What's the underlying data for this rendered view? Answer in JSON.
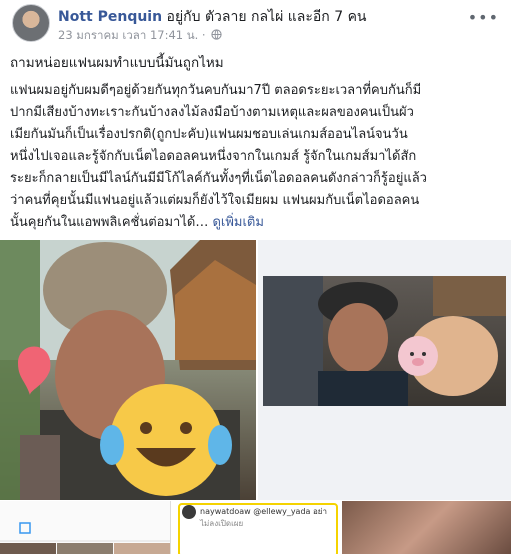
{
  "post": {
    "author": "Nott Penquin",
    "with_text": "อยู่กับ ตัวลาย กลไผ่ และอีก 7 คน",
    "timestamp": "23 มกราคม เวลา 17:41 น.",
    "timestamp_sep": " · ",
    "privacy_icon": "globe-icon",
    "more_icon": "ellipsis-icon",
    "more_symbol": "•••",
    "title": "ถามหน่อยแฟนผมทำแบบนี้มันถูกไหม",
    "body_lines": [
      "แฟนผมอยู่กับผมดีๆอยู่ด้วยกันทุกวันคบกันมา7ปี ตลอดระยะเวลาที่คบกันก็มี",
      "ปากมีเสียงบ้างทะเราะกันบ้างลงไม้ลงมือบ้างตามเหตุและผลของคนเป็นผัว",
      "เมียกันมันก็เป็นเรื่องปรกติ(ถูกปะคับ)แฟนผมชอบเล่นเกมส์ออนไลน์จนวัน",
      "หนึ่งไปเจอและรู้จักกับเน็ตไอดอลคนหนึ่งจากในเกมส์ รู้จักในเกมส์มาได้สัก",
      "ระยะก็กลายเป็นมีไลน์กันมีมีโก้ไลค์กันทั้งๆที่เน็ตไอดอลคนดังกล่าวก็รู้อยู่แล้ว",
      "ว่าคนที่คุยนั้นมีแฟนอยู่แล้วแต่ผมก็ยังไว้ใจเมียผม แฟนผมกับเน็ตไอดอลคน"
    ],
    "last_line": "นั้นคุยกันในแอพพลิเคชั่นต่อมาได้…",
    "see_more": "ดูเพิ่มเติม",
    "thumb2_user": "naywatdoaw @ellewy_yada อย่า",
    "thumb2_sub": "ไม่ลงเปิดเผย",
    "colors": {
      "link": "#385898",
      "meta": "#90949c",
      "text": "#1c1e21"
    }
  }
}
